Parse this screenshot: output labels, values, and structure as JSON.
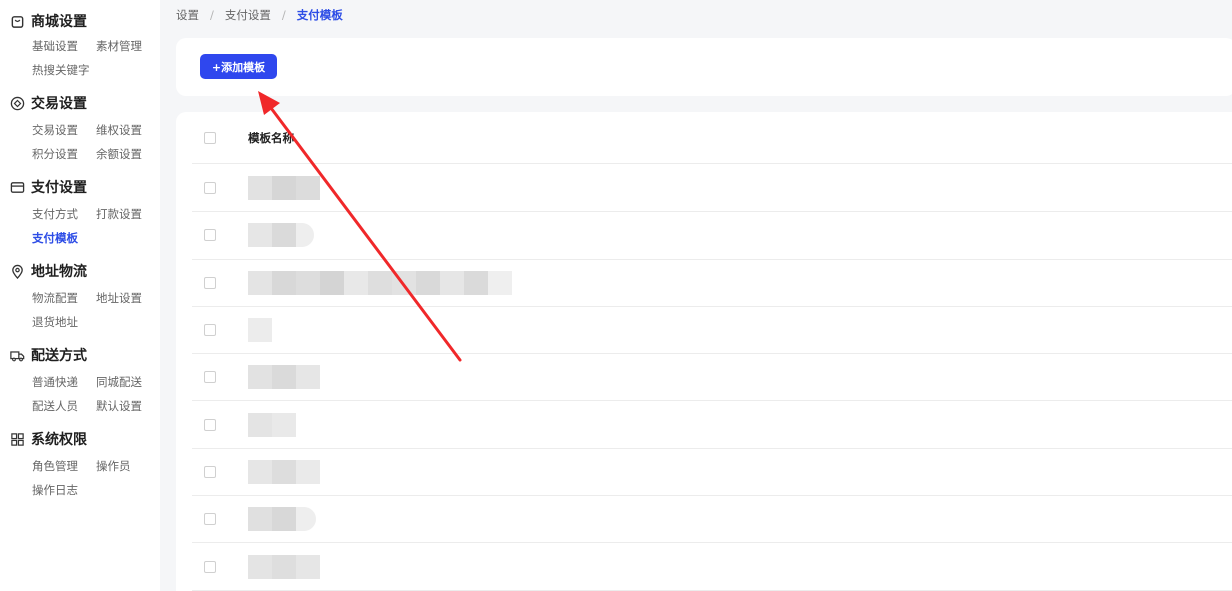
{
  "sidebar": {
    "groups": [
      {
        "title": "商城设置",
        "icon": "shop-bag-icon",
        "items": [
          "基础设置",
          "素材管理",
          "热搜关键字"
        ]
      },
      {
        "title": "交易设置",
        "icon": "trade-diamond-icon",
        "items": [
          "交易设置",
          "维权设置",
          "积分设置",
          "余额设置"
        ]
      },
      {
        "title": "支付设置",
        "icon": "card-icon",
        "items": [
          "支付方式",
          "打款设置",
          "支付模板"
        ]
      },
      {
        "title": "地址物流",
        "icon": "location-pin-icon",
        "items": [
          "物流配置",
          "地址设置",
          "退货地址"
        ]
      },
      {
        "title": "配送方式",
        "icon": "truck-icon",
        "items": [
          "普通快递",
          "同城配送",
          "配送人员",
          "默认设置"
        ]
      },
      {
        "title": "系统权限",
        "icon": "grid-icon",
        "items": [
          "角色管理",
          "操作员",
          "操作日志"
        ]
      }
    ],
    "active_item": "支付模板"
  },
  "breadcrumb": {
    "items": [
      "设置",
      "支付设置",
      "支付模板"
    ],
    "separator": "/"
  },
  "toolbar": {
    "add_label": "+添加模板"
  },
  "table": {
    "header": "模板名称",
    "row_count": 9
  },
  "colors": {
    "accent": "#2d4de6",
    "button": "#2f47ee",
    "arrow": "#f0282a"
  }
}
